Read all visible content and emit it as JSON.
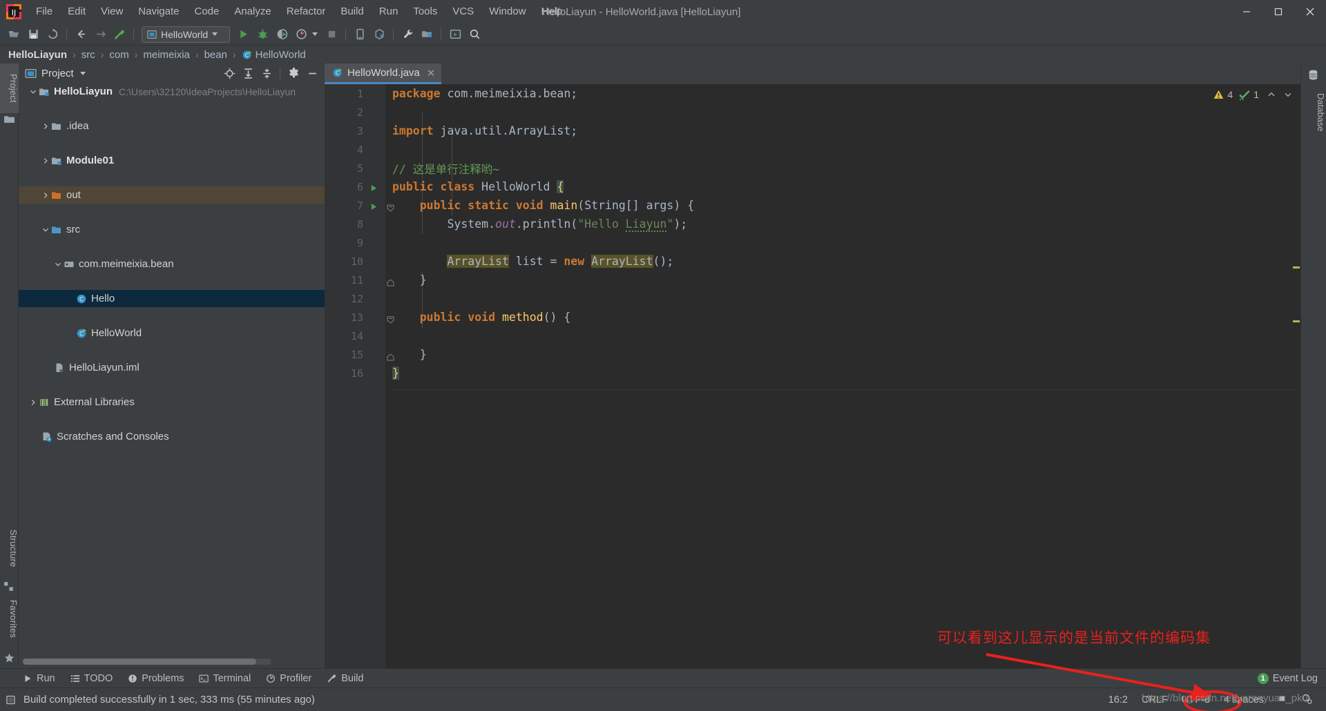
{
  "window": {
    "title": "HelloLiayun - HelloWorld.java [HelloLiayun]",
    "minimize_icon": "minimize-icon",
    "maximize_icon": "maximize-icon",
    "close_icon": "close-icon"
  },
  "menubar": {
    "items": [
      {
        "label": "File"
      },
      {
        "label": "Edit"
      },
      {
        "label": "View"
      },
      {
        "label": "Navigate"
      },
      {
        "label": "Code"
      },
      {
        "label": "Analyze"
      },
      {
        "label": "Refactor"
      },
      {
        "label": "Build"
      },
      {
        "label": "Run"
      },
      {
        "label": "Tools"
      },
      {
        "label": "VCS"
      },
      {
        "label": "Window"
      },
      {
        "label": "Help"
      }
    ]
  },
  "toolbar": {
    "open_icon": "open-folder-icon",
    "save_icon": "save-icon",
    "sync_icon": "sync-icon",
    "back_icon": "arrow-left-icon",
    "forward_icon": "arrow-right-icon",
    "build_icon": "hammer-icon",
    "run_config": "HelloWorld",
    "run_config_icon": "application-icon",
    "run_icon": "run-icon",
    "debug_icon": "debug-icon",
    "coverage_icon": "run-with-coverage-icon",
    "profile_icon": "profile-icon",
    "stop_icon": "stop-icon",
    "device_icon": "device-manager-icon",
    "update_project_icon": "update-project-icon",
    "settings_icon": "wrench-icon",
    "project_structure_icon": "project-structure-icon",
    "select_target_icon": "select-run-target-icon",
    "search_icon": "search-icon"
  },
  "breadcrumb": {
    "items": [
      {
        "label": "HelloLiayun",
        "bold": true,
        "icon": ""
      },
      {
        "label": "src",
        "bold": false,
        "icon": ""
      },
      {
        "label": "com",
        "bold": false,
        "icon": ""
      },
      {
        "label": "meimeixia",
        "bold": false,
        "icon": ""
      },
      {
        "label": "bean",
        "bold": false,
        "icon": ""
      },
      {
        "label": "HelloWorld",
        "bold": false,
        "icon": "java-class-run-icon"
      }
    ],
    "separator": "›"
  },
  "left_strip": {
    "project_tab": "Project",
    "structure_tab": "Structure",
    "favorites_tab": "Favorites"
  },
  "right_strip": {
    "database_tab": "Database"
  },
  "project_panel": {
    "title": "Project",
    "title_icon": "project-view-icon",
    "dropdown_icon": "chevron-down-icon",
    "tools": [
      {
        "name": "scroll-from-source-icon"
      },
      {
        "name": "expand-all-icon"
      },
      {
        "name": "collapse-all-icon"
      },
      {
        "name": "settings-gear-icon"
      },
      {
        "name": "hide-panel-icon"
      }
    ],
    "tree": [
      {
        "label": "HelloLiayun",
        "path": "C:\\Users\\32120\\IdeaProjects\\HelloLiayun",
        "indent": 0,
        "twist": "open",
        "icon": "module-folder-icon",
        "bold": true,
        "state": "none"
      },
      {
        "label": ".idea",
        "path": "",
        "indent": 1,
        "twist": "closed",
        "icon": "folder-icon",
        "bold": false,
        "state": "none"
      },
      {
        "label": "Module01",
        "path": "",
        "indent": 1,
        "twist": "closed",
        "icon": "module-folder-icon",
        "bold": true,
        "state": "none"
      },
      {
        "label": "out",
        "path": "",
        "indent": 1,
        "twist": "closed",
        "icon": "excluded-folder-icon",
        "bold": false,
        "state": "highlight"
      },
      {
        "label": "src",
        "path": "",
        "indent": 1,
        "twist": "open",
        "icon": "source-folder-icon",
        "bold": false,
        "state": "none"
      },
      {
        "label": "com.meimeixia.bean",
        "path": "",
        "indent": 2,
        "twist": "open",
        "icon": "package-icon",
        "bold": false,
        "state": "none"
      },
      {
        "label": "Hello",
        "path": "",
        "indent": 3,
        "twist": "none",
        "icon": "java-class-icon",
        "bold": false,
        "state": "selected"
      },
      {
        "label": "HelloWorld",
        "path": "",
        "indent": 3,
        "twist": "none",
        "icon": "java-class-run-icon",
        "bold": false,
        "state": "none"
      },
      {
        "label": "HelloLiayun.iml",
        "path": "",
        "indent": 1,
        "twist": "none",
        "icon": "iml-file-icon",
        "bold": false,
        "state": "none"
      },
      {
        "label": "External Libraries",
        "path": "",
        "indent": 0,
        "twist": "closed",
        "icon": "libraries-icon",
        "bold": false,
        "state": "none"
      },
      {
        "label": "Scratches and Consoles",
        "path": "",
        "indent": 0,
        "twist": "none",
        "icon": "scratches-icon",
        "bold": false,
        "state": "none"
      }
    ]
  },
  "editor": {
    "tab": {
      "label": "HelloWorld.java",
      "icon": "java-class-run-icon",
      "close_icon": "close-icon"
    },
    "inspections": {
      "warning_icon": "warning-triangle-icon",
      "warning_count": "4",
      "check_icon": "inspection-check-icon",
      "check_count": "1",
      "prev_icon": "chevron-up-icon",
      "next_icon": "chevron-down-icon"
    },
    "lines": [
      {
        "n": "1",
        "tokens": [
          {
            "t": "package",
            "c": "kwb"
          },
          {
            "t": " com.meimeixia.bean;",
            "c": "pln"
          }
        ]
      },
      {
        "n": "2",
        "tokens": []
      },
      {
        "n": "3",
        "tokens": [
          {
            "t": "import",
            "c": "kwb"
          },
          {
            "t": " java.util.ArrayList;",
            "c": "pln"
          }
        ]
      },
      {
        "n": "4",
        "tokens": []
      },
      {
        "n": "5",
        "tokens": [
          {
            "t": "// 这是单行注释哟~",
            "c": "cmt"
          }
        ]
      },
      {
        "n": "6",
        "tokens": [
          {
            "t": "public",
            "c": "kwb"
          },
          {
            "t": " ",
            "c": "pln"
          },
          {
            "t": "class",
            "c": "kwb"
          },
          {
            "t": " ",
            "c": "pln"
          },
          {
            "t": "HelloWorld",
            "c": "cls"
          },
          {
            "t": " ",
            "c": "pln"
          },
          {
            "t": "{",
            "c": "brace-hl"
          }
        ],
        "run": true
      },
      {
        "n": "7",
        "tokens": [
          {
            "t": "    ",
            "c": "pln"
          },
          {
            "t": "public",
            "c": "kwb"
          },
          {
            "t": " ",
            "c": "pln"
          },
          {
            "t": "static",
            "c": "kwb"
          },
          {
            "t": " ",
            "c": "pln"
          },
          {
            "t": "void",
            "c": "kwb"
          },
          {
            "t": " ",
            "c": "pln"
          },
          {
            "t": "main",
            "c": "mth"
          },
          {
            "t": "(String[] args) {",
            "c": "pln"
          }
        ],
        "run": true,
        "fold": true
      },
      {
        "n": "8",
        "tokens": [
          {
            "t": "        System.",
            "c": "pln"
          },
          {
            "t": "out",
            "c": "fld"
          },
          {
            "t": ".println(",
            "c": "pln"
          },
          {
            "t": "\"Hello ",
            "c": "str"
          },
          {
            "t": "Liayun",
            "c": "str wavy"
          },
          {
            "t": "\"",
            "c": "str"
          },
          {
            "t": ");",
            "c": "pln"
          }
        ]
      },
      {
        "n": "9",
        "tokens": []
      },
      {
        "n": "10",
        "tokens": [
          {
            "t": "        ",
            "c": "pln"
          },
          {
            "t": "ArrayList",
            "c": "cls ident-hl"
          },
          {
            "t": " list = ",
            "c": "pln"
          },
          {
            "t": "new",
            "c": "kwb"
          },
          {
            "t": " ",
            "c": "pln"
          },
          {
            "t": "ArrayList",
            "c": "cls ident-hl"
          },
          {
            "t": "();",
            "c": "pln"
          }
        ]
      },
      {
        "n": "11",
        "tokens": [
          {
            "t": "    }",
            "c": "pln"
          }
        ],
        "fold": true
      },
      {
        "n": "12",
        "tokens": []
      },
      {
        "n": "13",
        "tokens": [
          {
            "t": "    ",
            "c": "pln"
          },
          {
            "t": "public",
            "c": "kwb"
          },
          {
            "t": " ",
            "c": "pln"
          },
          {
            "t": "void",
            "c": "kwb"
          },
          {
            "t": " ",
            "c": "pln"
          },
          {
            "t": "method",
            "c": "mth"
          },
          {
            "t": "() {",
            "c": "pln"
          }
        ],
        "fold": true
      },
      {
        "n": "14",
        "tokens": []
      },
      {
        "n": "15",
        "tokens": [
          {
            "t": "    }",
            "c": "pln"
          }
        ],
        "fold": true
      },
      {
        "n": "16",
        "tokens": [
          {
            "t": "}",
            "c": "brace-hl"
          }
        ]
      }
    ]
  },
  "bottom_toolbar": {
    "items": [
      {
        "label": "Run",
        "icon": "run-icon"
      },
      {
        "label": "TODO",
        "icon": "todo-icon"
      },
      {
        "label": "Problems",
        "icon": "problems-icon"
      },
      {
        "label": "Terminal",
        "icon": "terminal-icon"
      },
      {
        "label": "Profiler",
        "icon": "profiler-icon"
      },
      {
        "label": "Build",
        "icon": "hammer-icon"
      }
    ],
    "event_log": {
      "label": "Event Log",
      "badge": "1"
    }
  },
  "statusbar": {
    "message": "Build completed successfully in 1 sec, 333 ms (55 minutes ago)",
    "message_icon": "console-icon",
    "caret_position": "16:2",
    "line_separator": "CRLF",
    "encoding": "UTF-8",
    "indent": "4 spaces",
    "git_branch": "",
    "lock_icon": "read-only-icon",
    "inspection_icon": "inspection-settings-icon"
  },
  "annotation": {
    "text": "可以看到这儿显示的是当前文件的编码集",
    "color": "#e8211c",
    "target": "UTF-8"
  },
  "watermark": {
    "text": "https://blog.csdn.net/yerenyuan_pku"
  }
}
